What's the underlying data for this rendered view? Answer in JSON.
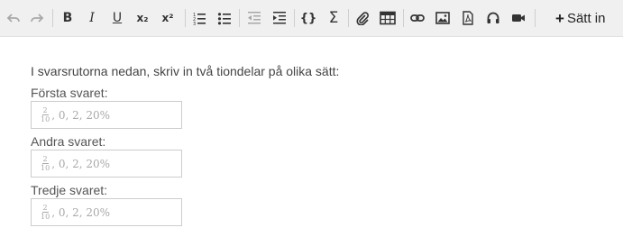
{
  "toolbar": {
    "insert_label": "Sätt in",
    "insert_plus": "+",
    "bold": "B",
    "italic": "I",
    "underline": "U",
    "subscript": "x₂",
    "superscript": "x²",
    "code_braces": "{}",
    "sum": "Σ",
    "undo_enabled": false,
    "redo_enabled": false,
    "indent_decrease_enabled": false
  },
  "question": {
    "instruction": "I svarsrutorna nedan, skriv in två tiondelar på olika sätt:",
    "answers": [
      {
        "label": "Första svaret:",
        "placeholder_num": "2",
        "placeholder_den": "10",
        "placeholder_rest": ", 0, 2, 20%"
      },
      {
        "label": "Andra svaret:",
        "placeholder_num": "2",
        "placeholder_den": "10",
        "placeholder_rest": ", 0, 2, 20%"
      },
      {
        "label": "Tredje svaret:",
        "placeholder_num": "2",
        "placeholder_den": "10",
        "placeholder_rest": ", 0, 2, 20%"
      }
    ]
  }
}
